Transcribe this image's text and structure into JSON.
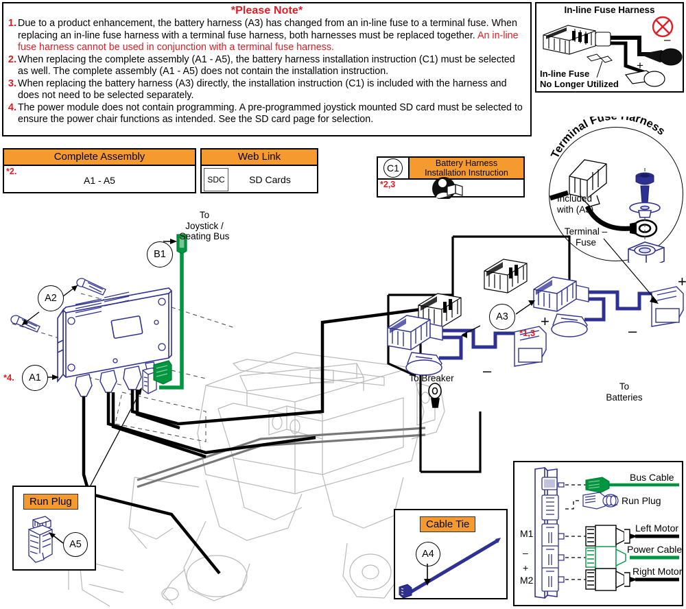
{
  "colors": {
    "orange": "#f59a2e",
    "red": "#e31b23",
    "blue": "#2e3192",
    "green": "#00963f",
    "black": "#000000",
    "gray": "#808080"
  },
  "note_panel": {
    "title": "*Please Note*",
    "items": [
      {
        "num": "1.",
        "text_black_1": "Due to a product enhancement, the battery harness (A3) has changed from an in-line fuse to a terminal fuse. When replacing an in-line fuse harness with a terminal fuse harness, both harnesses must be replaced together. ",
        "text_red": "An in-line fuse harness cannot be used in conjunction with a terminal fuse harness."
      },
      {
        "num": "2.",
        "text_black_1": "When replacing the complete assembly (A1 - A5), the battery harness installation instruction (C1) must be selected as well. The complete assembly (A1 - A5) does not contain the installation instruction.",
        "text_red": ""
      },
      {
        "num": "3.",
        "text_black_1": "When replacing the battery harness (A3) directly, the installation instruction (C1) is included with the harness and does not need to be selected separately.",
        "text_red": ""
      },
      {
        "num": "4.",
        "text_black_1": "The power module does not contain programming. A pre-programmed joystick mounted SD card must be selected to ensure the power chair functions as intended. See the SD card page for selection.",
        "text_red": ""
      }
    ]
  },
  "inline_fuse_box": {
    "title": "In-line Fuse Harness",
    "caption_line1": "In-line Fuse",
    "caption_line2": "No Longer Utilized",
    "plus_sign": "+",
    "minus_sign": "–",
    "prohibited_icon": "no-symbol-icon"
  },
  "terminal_fuse_circle": {
    "title": "Terminal Fuse Harness",
    "included_line1": "Included",
    "included_line2": "with (A3)",
    "terminal_line1": "Terminal –",
    "terminal_line2": "Fuse"
  },
  "complete_assembly_table": {
    "header": "Complete Assembly",
    "star": "*2.",
    "value": "A1 - A5"
  },
  "web_link_table": {
    "header": "Web Link",
    "code": "SDC",
    "value": "SD Cards"
  },
  "instruction_box": {
    "ref": "C1",
    "title_line1": "Battery Harness",
    "title_line2": "Installation Instruction",
    "star": "*2,3",
    "icon": "read-instructions-icon"
  },
  "main_diagram": {
    "callouts": [
      {
        "id": "A1",
        "label": "A1",
        "star": "*4."
      },
      {
        "id": "A2",
        "label": "A2",
        "star": ""
      },
      {
        "id": "A3",
        "label": "A3",
        "star": "*1,3"
      },
      {
        "id": "A4",
        "label": "A4",
        "star": ""
      },
      {
        "id": "A5",
        "label": "A5",
        "star": ""
      },
      {
        "id": "B1",
        "label": "B1",
        "star": ""
      }
    ],
    "labels": {
      "to_joystick_l1": "To",
      "to_joystick_l2": "Joystick /",
      "to_joystick_l3": "Seating Bus",
      "to_breaker": "To Breaker",
      "to_batteries_l1": "To",
      "to_batteries_l2": "Batteries",
      "plus": "+",
      "minus": "–"
    }
  },
  "run_plug_box": {
    "title": "Run Plug",
    "ref": "A5"
  },
  "cable_tie_box": {
    "title": "Cable Tie",
    "ref": "A4"
  },
  "legend_box": {
    "side_labels": [
      "M1",
      "–",
      "+",
      "M2"
    ],
    "rows": [
      {
        "label": "Bus Cable",
        "color": "#00963f"
      },
      {
        "label": "Run Plug",
        "color": "#2e3192"
      },
      {
        "label": "Left Motor",
        "color": "#000000"
      },
      {
        "label": "Power Cable",
        "color": "#00963f"
      },
      {
        "label": "Right Motor",
        "color": "#000000"
      }
    ]
  }
}
